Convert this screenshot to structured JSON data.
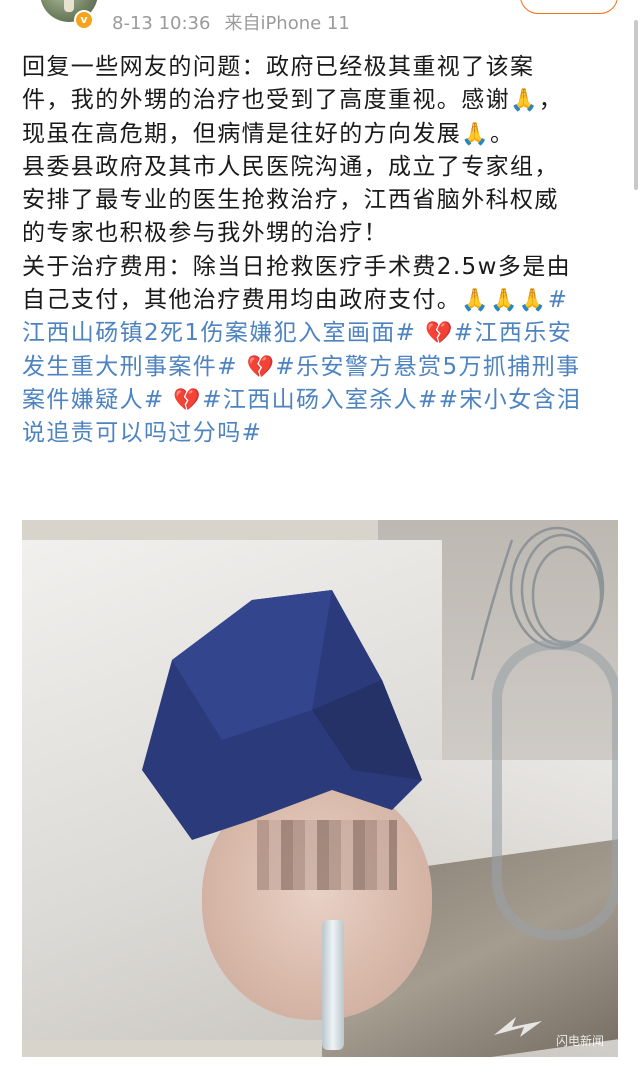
{
  "post": {
    "timestamp": "8-13 10:36",
    "source": "来自iPhone 11",
    "lines": [
      "回复一些网友的问题：政府已经极其重视了该案",
      "件，我的外甥的治疗也受到了高度重视。感谢",
      "现虽在高危期，但病情是往好的方向发展",
      "县委县政府及其市人民医院沟通，成立了专家组，",
      "安排了最专业的医生抢救治疗，江西省脑外科权威",
      "的专家也积极参与我外甥的治疗！",
      "关于治疗费用：除当日抢救医疗手术费2.5w多是由",
      "自己支付，其他治疗费用均由政府支付。"
    ],
    "line2_tail": "，",
    "line3_tail": "。",
    "hashtags": {
      "tag1_start": "#",
      "tag1_line2": "江西山砀镇2死1伤案嫌犯入室画面#",
      "tag2_line1": "#江西乐安",
      "tag2_line2": "发生重大刑事案件#",
      "tag3_line1": "#乐安警方悬赏5万抓捕刑事",
      "tag3_line2": "案件嫌疑人#",
      "tag4": "#江西山砀入室杀人#",
      "tag5_line1": "#宋小女含泪",
      "tag5_line2": "说追责可以吗过分吗#"
    },
    "emoji": {
      "pray": "🙏",
      "broken_heart": "💔"
    }
  },
  "photo": {
    "description_icon": "photo-icon"
  },
  "watermark": {
    "text": "闪电新闻"
  },
  "colors": {
    "hashtag": "#4d83c0",
    "meta_text": "#9a9a9a",
    "accent_follow": "#f1701b",
    "verified": "#f7a21b"
  }
}
